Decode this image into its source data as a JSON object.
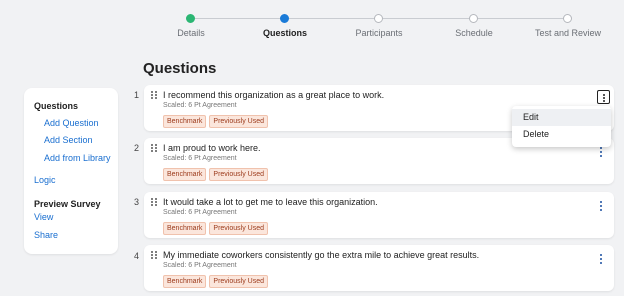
{
  "stepper": {
    "steps": [
      {
        "label": "Details",
        "state": "done"
      },
      {
        "label": "Questions",
        "state": "active"
      },
      {
        "label": "Participants",
        "state": "pending"
      },
      {
        "label": "Schedule",
        "state": "pending"
      },
      {
        "label": "Test and Review",
        "state": "pending"
      }
    ]
  },
  "page_title": "Questions",
  "sidebar": {
    "questions_heading": "Questions",
    "add_question": "Add Question",
    "add_section": "Add Section",
    "add_from_library": "Add from Library",
    "logic": "Logic",
    "preview_heading": "Preview Survey",
    "view": "View",
    "share": "Share"
  },
  "questions": [
    {
      "number": "1",
      "text": "I recommend this organization as a great place to work.",
      "scale": "Scaled: 6 Pt Agreement",
      "tags": [
        "Benchmark",
        "Previously Used"
      ]
    },
    {
      "number": "2",
      "text": "I am proud to work here.",
      "scale": "Scaled: 6 Pt Agreement",
      "tags": [
        "Benchmark",
        "Previously Used"
      ]
    },
    {
      "number": "3",
      "text": "It would take a lot to get me to leave this organization.",
      "scale": "Scaled: 6 Pt Agreement",
      "tags": [
        "Benchmark",
        "Previously Used"
      ]
    },
    {
      "number": "4",
      "text": "My immediate coworkers consistently go the extra mile to achieve great results.",
      "scale": "Scaled: 6 Pt Agreement",
      "tags": [
        "Benchmark",
        "Previously Used"
      ]
    }
  ],
  "context_menu": {
    "items": [
      "Edit",
      "Delete"
    ]
  },
  "icons": {
    "more": "more-vertical-icon",
    "drag": "drag-handle-icon"
  },
  "colors": {
    "accent": "#1a7bd8",
    "done": "#2bb673",
    "tag_text": "#9c3b1c",
    "tag_bg": "#fbe6dc"
  }
}
